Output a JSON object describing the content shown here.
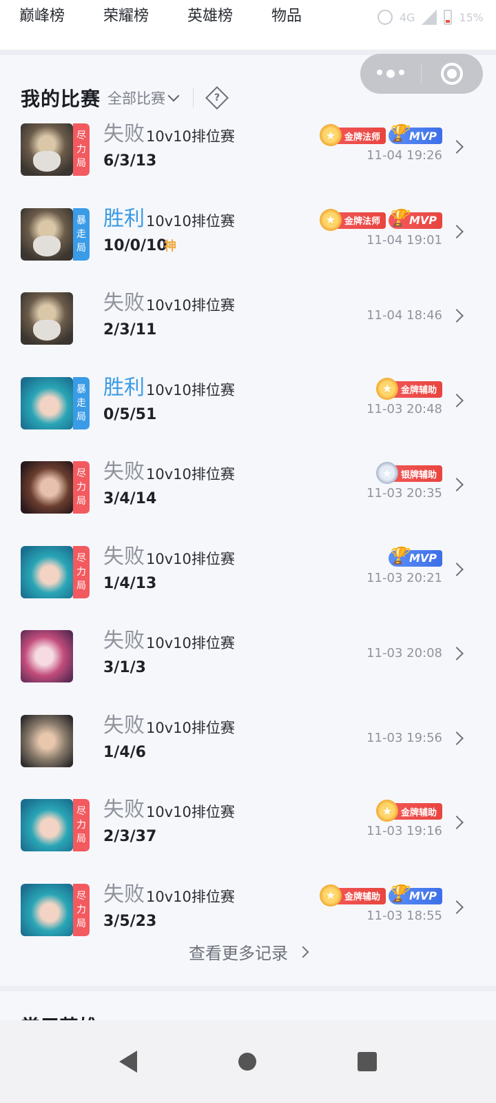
{
  "top_tabs": [
    "巅峰榜",
    "荣耀榜",
    "英雄榜",
    "物品"
  ],
  "status": {
    "extra": "4G",
    "battery": "15%"
  },
  "section": {
    "title": "我的比赛",
    "filter_label": "全部比赛",
    "help_symbol": "?"
  },
  "matches": [
    {
      "hero_icon": "zeus-hero-icon",
      "tag": "尽力局",
      "tag_color": "#f25a5f",
      "result": "失败",
      "result_type": "lose",
      "mode": "10v10排位赛",
      "kda": "6/3/13",
      "god": "",
      "badges": [
        {
          "type": "gold",
          "text": "金牌法师"
        },
        {
          "type": "mvp",
          "text": "MVP"
        }
      ],
      "time": "11-04 19:26"
    },
    {
      "hero_icon": "zeus-hero-icon",
      "tag": "暴走局",
      "tag_color": "#3a9be6",
      "result": "胜利",
      "result_type": "win",
      "mode": "10v10排位赛",
      "kda": "10/0/10",
      "god": "神",
      "badges": [
        {
          "type": "gold",
          "text": "金牌法师"
        },
        {
          "type": "mvp-gold",
          "text": "MVP"
        }
      ],
      "time": "11-04 19:01"
    },
    {
      "hero_icon": "zeus-hero-icon",
      "tag": "",
      "tag_color": "",
      "result": "失败",
      "result_type": "lose",
      "mode": "10v10排位赛",
      "kda": "2/3/11",
      "god": "",
      "badges": [],
      "time": "11-04 18:46"
    },
    {
      "hero_icon": "mermaid-hero-icon",
      "tag": "暴走局",
      "tag_color": "#3a9be6",
      "result": "胜利",
      "result_type": "win",
      "mode": "10v10排位赛",
      "kda": "0/5/51",
      "god": "",
      "badges": [
        {
          "type": "gold",
          "text": "金牌辅助"
        }
      ],
      "time": "11-03 20:48"
    },
    {
      "hero_icon": "dark-hair-hero-icon",
      "tag": "尽力局",
      "tag_color": "#f25a5f",
      "result": "失败",
      "result_type": "lose",
      "mode": "10v10排位赛",
      "kda": "3/4/14",
      "god": "",
      "badges": [
        {
          "type": "silver",
          "text": "银牌辅助"
        }
      ],
      "time": "11-03 20:35"
    },
    {
      "hero_icon": "mermaid-hero-icon",
      "tag": "尽力局",
      "tag_color": "#f25a5f",
      "result": "失败",
      "result_type": "lose",
      "mode": "10v10排位赛",
      "kda": "1/4/13",
      "god": "",
      "badges": [
        {
          "type": "mvp",
          "text": "MVP"
        }
      ],
      "time": "11-03 20:21"
    },
    {
      "hero_icon": "pink-hair-hero-icon",
      "tag": "",
      "tag_color": "",
      "result": "失败",
      "result_type": "lose",
      "mode": "10v10排位赛",
      "kda": "3/1/3",
      "god": "",
      "badges": [],
      "time": "11-03 20:08"
    },
    {
      "hero_icon": "warrior-hero-icon",
      "tag": "",
      "tag_color": "",
      "result": "失败",
      "result_type": "lose",
      "mode": "10v10排位赛",
      "kda": "1/4/6",
      "god": "",
      "badges": [],
      "time": "11-03 19:56"
    },
    {
      "hero_icon": "mermaid-hero-icon",
      "tag": "尽力局",
      "tag_color": "#f25a5f",
      "result": "失败",
      "result_type": "lose",
      "mode": "10v10排位赛",
      "kda": "2/3/37",
      "god": "",
      "badges": [
        {
          "type": "gold",
          "text": "金牌辅助"
        }
      ],
      "time": "11-03 19:16"
    },
    {
      "hero_icon": "mermaid-hero-icon",
      "tag": "尽力局",
      "tag_color": "#f25a5f",
      "result": "失败",
      "result_type": "lose",
      "mode": "10v10排位赛",
      "kda": "3/5/23",
      "god": "",
      "badges": [
        {
          "type": "gold",
          "text": "金牌辅助"
        },
        {
          "type": "mvp",
          "text": "MVP"
        }
      ],
      "time": "11-03 18:55"
    }
  ],
  "more_records": "查看更多记录",
  "next_section_title": "常用英雄"
}
